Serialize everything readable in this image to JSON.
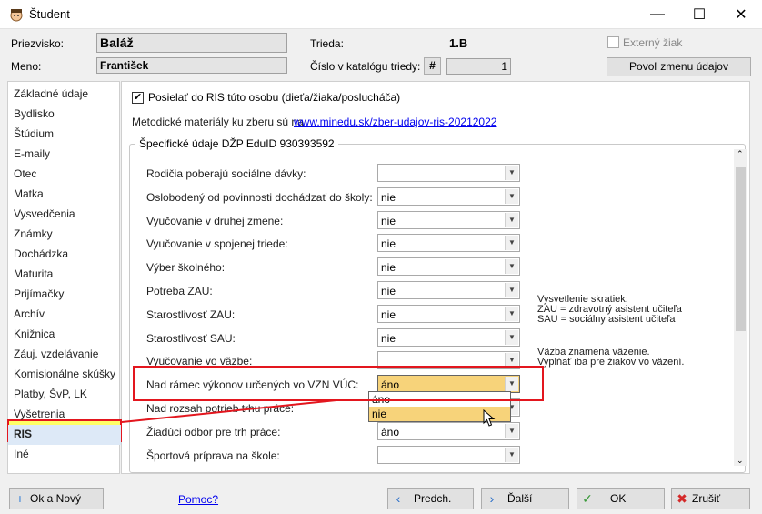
{
  "window": {
    "title": "Študent",
    "minimize_glyph": "—",
    "maximize_glyph": "☐",
    "close_glyph": "✕"
  },
  "header": {
    "surname_label": "Priezvisko:",
    "surname_value": "Baláž",
    "name_label": "Meno:",
    "name_value": "František",
    "class_label": "Trieda:",
    "class_value": "1.B",
    "catalog_label": "Číslo v katalógu triedy:",
    "catalog_hash": "#",
    "catalog_value": "1",
    "external_label": "Externý žiak",
    "allow_edit_button": "Povoľ zmenu údajov"
  },
  "sidebar": {
    "items": [
      "Základné údaje",
      "Bydlisko",
      "Štúdium",
      "E-maily",
      "Otec",
      "Matka",
      "Vysvedčenia",
      "Známky",
      "Dochádzka",
      "Maturita",
      "Prijímačky",
      "Archív",
      "Knižnica",
      "Záuj. vzdelávanie",
      "Komisionálne skúšky",
      "Platby, ŠvP, LK",
      "Vyšetrenia",
      "RIS",
      "Iné"
    ],
    "selected": "RIS"
  },
  "ris": {
    "send_checkbox_label": "Posielať do RIS túto osobu (dieťa/žiaka/poslucháča)",
    "materials_text": "Metodické materiály ku zberu sú na ",
    "materials_link": "www.minedu.sk/zber-udajov-ris-20212022",
    "group_title": "Špecifické údaje DŽP EduID 930393592",
    "fields": [
      {
        "label": "Rodičia poberajú sociálne dávky:",
        "value": ""
      },
      {
        "label": "Oslobodený od povinnosti dochádzať do školy:",
        "value": "nie"
      },
      {
        "label": "Vyučovanie v druhej zmene:",
        "value": "nie"
      },
      {
        "label": "Vyučovanie v spojenej triede:",
        "value": "nie"
      },
      {
        "label": "Výber školného:",
        "value": "nie"
      },
      {
        "label": "Potreba ZAU:",
        "value": "nie"
      },
      {
        "label": "Starostlivosť ZAU:",
        "value": "nie"
      },
      {
        "label": "Starostlivosť SAU:",
        "value": "nie"
      },
      {
        "label": "Vyučovanie vo väzbe:",
        "value": ""
      },
      {
        "label": "Nad rámec výkonov určených vo VZN VÚC:",
        "value": "áno"
      },
      {
        "label": "Nad rozsah potrieb trhu práce:",
        "value": ""
      },
      {
        "label": "Žiadúci odbor pre trh práce:",
        "value": "áno"
      },
      {
        "label": "Športová príprava na škole:",
        "value": ""
      }
    ],
    "dropdown_options": [
      "áno",
      "nie"
    ],
    "dropdown_hover": "nie",
    "note_title": "Vysvetlenie skratiek:",
    "note_zau": "ZAU = zdravotný asistent učiteľa",
    "note_sau": "SAU = sociálny asistent učiteľa",
    "note_custody1": "Väzba znamená väzenie.",
    "note_custody2": "Vyplňať iba pre žiakov vo väzení."
  },
  "footer": {
    "ok_new": "Ok a Nový",
    "help": "Pomoc?",
    "prev": "Predch.",
    "next": "Ďalší",
    "ok": "OK",
    "cancel": "Zrušiť"
  },
  "colors": {
    "highlight": "#e3161e",
    "highlight_fill": "#ffff66",
    "hover": "#f7d37a"
  }
}
